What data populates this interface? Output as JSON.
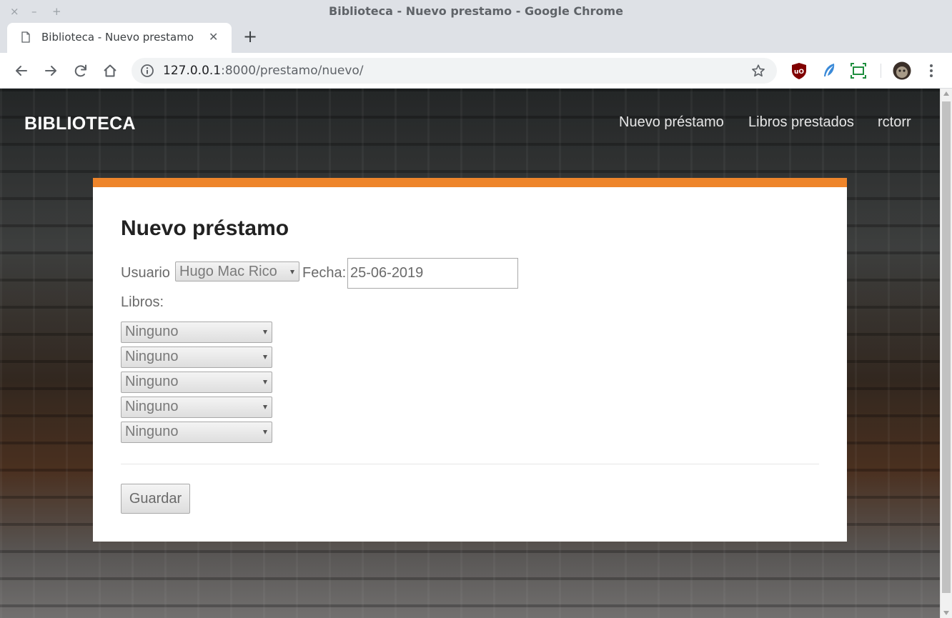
{
  "window": {
    "title": "Biblioteca - Nuevo prestamo - Google Chrome",
    "controls": {
      "close": "×",
      "minimize": "–",
      "maximize": "+"
    }
  },
  "tab": {
    "title": "Biblioteca - Nuevo prestamo",
    "close": "✕",
    "new_tab": "+"
  },
  "omnibox": {
    "host": "127.0.0.1",
    "rest": ":8000/prestamo/nuevo/"
  },
  "toolbar_icons": [
    "back-arrow-icon",
    "forward-arrow-icon",
    "reload-icon",
    "home-icon",
    "info-icon",
    "star-icon",
    "ublock-icon",
    "feather-icon",
    "screenshot-icon",
    "profile-avatar",
    "menu-dots-icon"
  ],
  "colors": {
    "accent": "#ee852b",
    "brand_text": "#ffffff"
  },
  "site": {
    "brand": "BIBLIOTECA",
    "nav": [
      "Nuevo préstamo",
      "Libros prestados",
      "rctorr"
    ]
  },
  "form": {
    "title": "Nuevo préstamo",
    "usuario_label": "Usuario",
    "usuario_value": "Hugo Mac Rico",
    "fecha_label": "Fecha:",
    "fecha_value": "25-06-2019",
    "libros_label": "Libros:",
    "libros": [
      "Ninguno",
      "Ninguno",
      "Ninguno",
      "Ninguno",
      "Ninguno"
    ],
    "save_label": "Guardar"
  }
}
